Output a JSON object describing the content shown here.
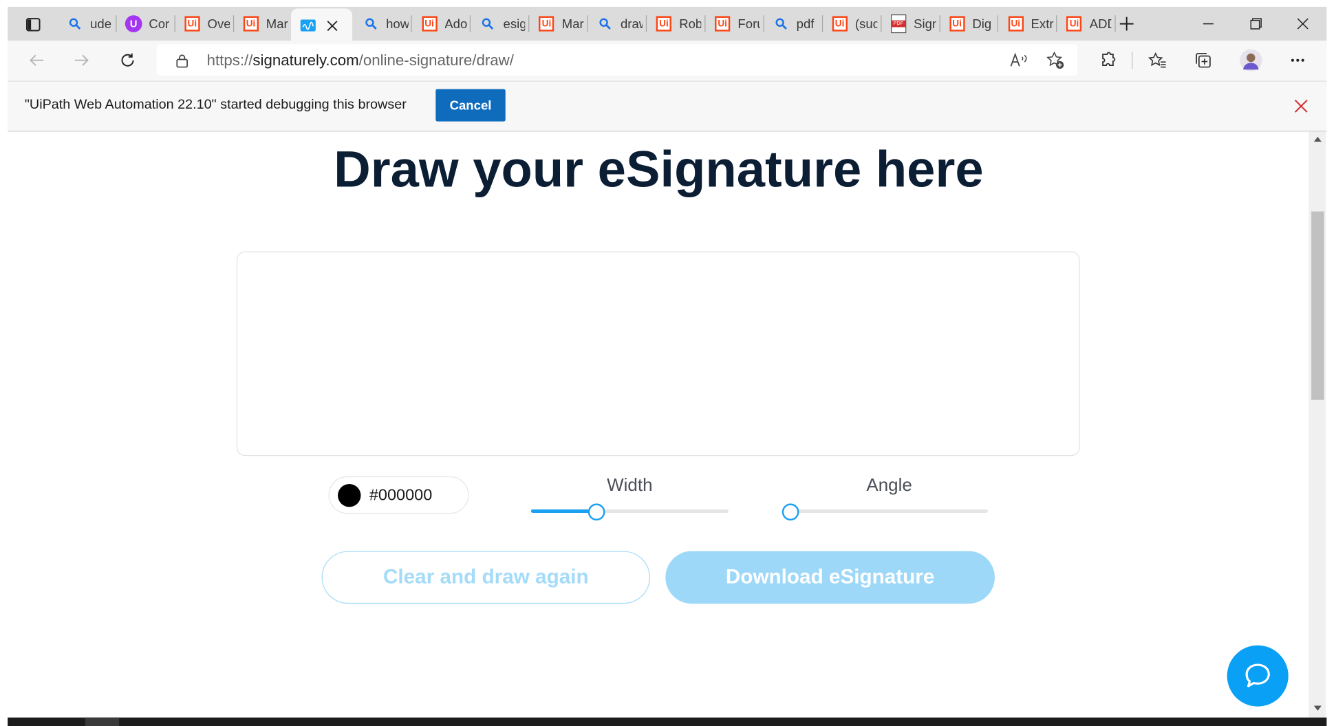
{
  "browser": {
    "tabs": [
      {
        "icon": "search-icon",
        "title": "ude"
      },
      {
        "icon": "udemy-icon",
        "title": "Cor"
      },
      {
        "icon": "uipath-icon",
        "title": "Ove"
      },
      {
        "icon": "uipath-icon",
        "title": "Mar"
      },
      {
        "icon": "signaturely-icon",
        "title": "",
        "active": true
      },
      {
        "icon": "search-icon",
        "title": "how"
      },
      {
        "icon": "uipath-icon",
        "title": "Ado"
      },
      {
        "icon": "search-icon",
        "title": "esig"
      },
      {
        "icon": "uipath-icon",
        "title": "Mar"
      },
      {
        "icon": "search-icon",
        "title": "draw"
      },
      {
        "icon": "uipath-icon",
        "title": "Rob"
      },
      {
        "icon": "uipath-icon",
        "title": "Foru"
      },
      {
        "icon": "search-icon",
        "title": "pdf"
      },
      {
        "icon": "uipath-icon",
        "title": "(suc"
      },
      {
        "icon": "pdf-icon",
        "title": "Sign"
      },
      {
        "icon": "uipath-icon",
        "title": "Dig"
      },
      {
        "icon": "uipath-icon",
        "title": "Extr"
      },
      {
        "icon": "uipath-icon",
        "title": "ADD"
      }
    ],
    "url_prefix": "https://",
    "url_domain": "signaturely.com",
    "url_path": "/online-signature/draw/",
    "pdf_icon_text": "PDF",
    "uipath_icon_text": "Ui",
    "udemy_icon_text": "U"
  },
  "infobar": {
    "message": "\"UiPath Web Automation 22.10\" started debugging this browser",
    "cancel_label": "Cancel"
  },
  "page": {
    "title": "Draw your eSignature here",
    "color_value": "#000000",
    "color_swatch": "#000000",
    "width_label": "Width",
    "width_level": 0.33,
    "angle_label": "Angle",
    "angle_level": 0,
    "clear_label": "Clear and draw again",
    "download_label": "Download eSignature"
  },
  "colors": {
    "accent": "#1ba1f2",
    "title": "#0b1e34",
    "infobar_button": "#0f6cbd",
    "chat_button": "#0aa0f5"
  }
}
